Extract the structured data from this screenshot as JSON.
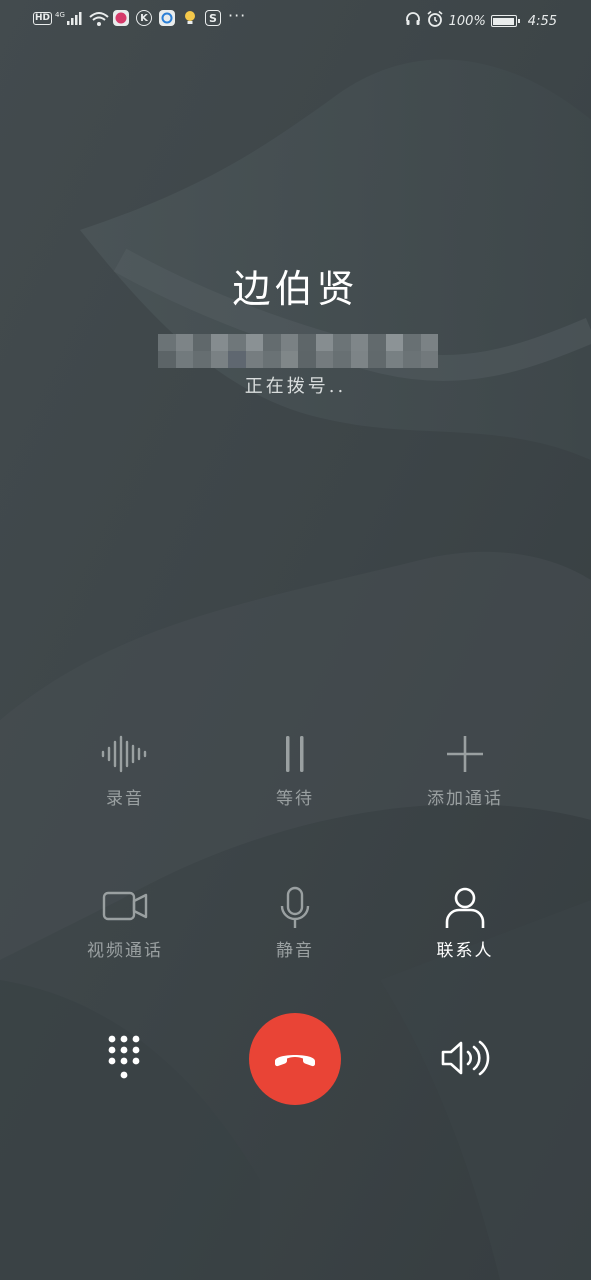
{
  "status_bar": {
    "hd": "HD",
    "network": "4G",
    "battery": "100%",
    "time": "4:55",
    "more": "···"
  },
  "caller": {
    "name": "边伯贤",
    "status": "正在拨号.."
  },
  "actions": {
    "record": "录音",
    "hold": "等待",
    "add_call": "添加通话",
    "video_call": "视频通话",
    "mute": "静音",
    "contacts": "联系人"
  },
  "colors": {
    "end_call": "#e94436",
    "inactive": "#9aa0a1",
    "active": "#ffffff"
  }
}
